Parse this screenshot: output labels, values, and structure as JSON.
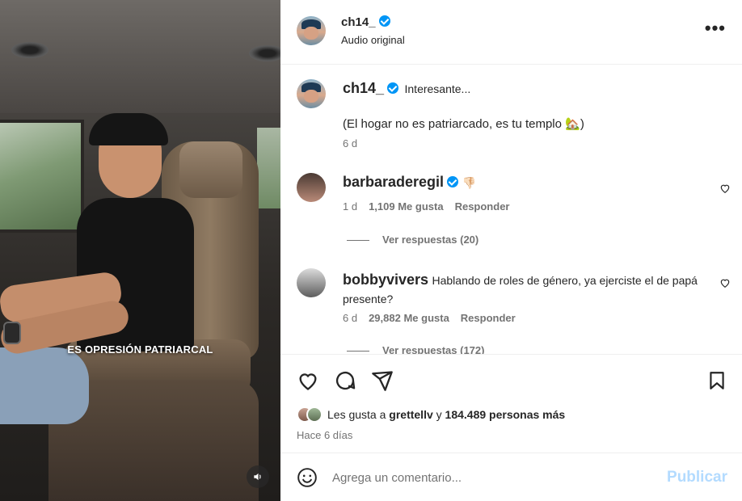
{
  "video": {
    "caption": "ES OPRESIÓN PATRIARCAL"
  },
  "header": {
    "username": "ch14_",
    "subtitle": "Audio original",
    "more_label": "•••"
  },
  "caption_post": {
    "username": "ch14_",
    "text": "Interesante...",
    "body": "(El hogar no es patriarcado, es tu templo 🏡)",
    "age": "6 d"
  },
  "comments": [
    {
      "username": "barbaraderegil",
      "text": "👎🏻",
      "age": "1 d",
      "likes": "1,109 Me gusta",
      "reply": "Responder",
      "view_replies": "Ver respuestas (20)"
    },
    {
      "username": "bobbyvivers",
      "text": "Hablando de roles de género, ya ejerciste el de papá presente?",
      "age": "6 d",
      "likes": "29,882 Me gusta",
      "reply": "Responder",
      "view_replies": "Ver respuestas (172)"
    }
  ],
  "likes": {
    "prefix": "Les gusta a",
    "user": "grettellv",
    "conj": "y",
    "others": "184.489 personas más"
  },
  "posted_ago": "Hace 6 días",
  "composer": {
    "placeholder": "Agrega un comentario...",
    "publish": "Publicar"
  },
  "colors": {
    "verified": "#0095f6",
    "publish_disabled": "#b3dbff",
    "muted_text": "#737373"
  },
  "icons": [
    "more-icon",
    "heart-icon",
    "comment-icon",
    "share-icon",
    "bookmark-icon",
    "emoji-icon",
    "sound-icon",
    "verified-icon"
  ]
}
